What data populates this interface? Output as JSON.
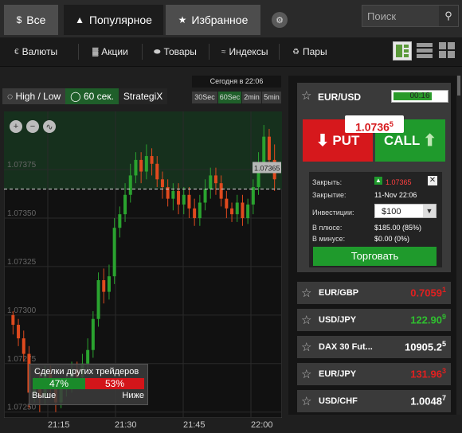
{
  "tabs": [
    {
      "label": "Все",
      "icon": "dollar-icon"
    },
    {
      "label": "Популярное",
      "icon": "flame-icon"
    },
    {
      "label": "Избранное",
      "icon": "star-icon"
    }
  ],
  "search": {
    "placeholder": "Поиск"
  },
  "categories": [
    "Валюты",
    "Акции",
    "Товары",
    "Индексы",
    "Пары"
  ],
  "option_types": [
    "High / Low",
    "60 сек.",
    "StrategiX"
  ],
  "expiry_label": "Сегодня в 22:06",
  "timeframes": [
    "30Sec",
    "60Sec",
    "2min",
    "5min"
  ],
  "colors": {
    "up": "#2aa32f",
    "down": "#e04a1e",
    "accent_green": "#1f9a2c",
    "put_red": "#d6181c"
  },
  "chart_data": {
    "type": "candlestick",
    "symbol": "EUR/USD",
    "y_ticks": [
      1.07375,
      1.0735,
      1.07325,
      1.073,
      1.07275,
      1.0725
    ],
    "x_ticks": [
      "21:15",
      "21:30",
      "21:45",
      "22:00"
    ],
    "current_price": 1.07365,
    "current_price_label": "1.07365",
    "ylim": [
      1.07247,
      1.07405
    ],
    "candles": [
      [
        1.073,
        1.07295,
        1.07302,
        1.0729
      ],
      [
        1.07295,
        1.07288,
        1.07298,
        1.07284
      ],
      [
        1.07288,
        1.0728,
        1.07292,
        1.07276
      ],
      [
        1.0728,
        1.0726,
        1.07284,
        1.07252
      ],
      [
        1.0726,
        1.07265,
        1.07268,
        1.07255
      ],
      [
        1.07265,
        1.07258,
        1.0727,
        1.0725
      ],
      [
        1.07258,
        1.0727,
        1.07274,
        1.07254
      ],
      [
        1.0727,
        1.07262,
        1.07274,
        1.07258
      ],
      [
        1.07262,
        1.07255,
        1.07266,
        1.0725
      ],
      [
        1.07255,
        1.07262,
        1.07266,
        1.07252
      ],
      [
        1.07262,
        1.07265,
        1.07268,
        1.07258
      ],
      [
        1.07265,
        1.07272,
        1.07276,
        1.0726
      ],
      [
        1.07272,
        1.07268,
        1.07276,
        1.07262
      ],
      [
        1.07268,
        1.07275,
        1.0728,
        1.07264
      ],
      [
        1.07275,
        1.07282,
        1.07288,
        1.07272
      ],
      [
        1.07282,
        1.07298,
        1.07302,
        1.07278
      ],
      [
        1.07298,
        1.07318,
        1.07322,
        1.07294
      ],
      [
        1.07318,
        1.07312,
        1.07324,
        1.07306
      ],
      [
        1.07312,
        1.0732,
        1.07326,
        1.07308
      ],
      [
        1.0732,
        1.07345,
        1.0735,
        1.07316
      ],
      [
        1.07345,
        1.07352,
        1.07356,
        1.0734
      ],
      [
        1.07352,
        1.07362,
        1.07368,
        1.07348
      ],
      [
        1.07362,
        1.07372,
        1.07378,
        1.07358
      ],
      [
        1.07372,
        1.0738,
        1.07384,
        1.07368
      ],
      [
        1.0738,
        1.07374,
        1.07384,
        1.07368
      ],
      [
        1.07374,
        1.07382,
        1.07388,
        1.0737
      ],
      [
        1.07382,
        1.07378,
        1.07386,
        1.07372
      ],
      [
        1.07378,
        1.0737,
        1.07382,
        1.07366
      ],
      [
        1.0737,
        1.07366,
        1.07374,
        1.0736
      ],
      [
        1.07366,
        1.0736,
        1.0737,
        1.07356
      ],
      [
        1.0736,
        1.07364,
        1.07368,
        1.07354
      ],
      [
        1.07364,
        1.07357,
        1.07368,
        1.07352
      ],
      [
        1.07357,
        1.07362,
        1.07366,
        1.07352
      ],
      [
        1.07362,
        1.07355,
        1.07366,
        1.0735
      ],
      [
        1.07355,
        1.0735,
        1.0736,
        1.07346
      ],
      [
        1.0735,
        1.07358,
        1.07362,
        1.07346
      ],
      [
        1.07358,
        1.07365,
        1.0737,
        1.07354
      ],
      [
        1.07365,
        1.07372,
        1.07376,
        1.0736
      ],
      [
        1.07372,
        1.07368,
        1.07376,
        1.07362
      ],
      [
        1.07368,
        1.0736,
        1.07372,
        1.07356
      ],
      [
        1.0736,
        1.07355,
        1.07364,
        1.0735
      ],
      [
        1.07355,
        1.07352,
        1.07358,
        1.07348
      ],
      [
        1.07352,
        1.07358,
        1.07362,
        1.07348
      ],
      [
        1.07358,
        1.0735,
        1.07362,
        1.07346
      ],
      [
        1.0735,
        1.07357,
        1.0736,
        1.07347
      ],
      [
        1.07357,
        1.07366,
        1.0737,
        1.07352
      ],
      [
        1.07366,
        1.07378,
        1.07384,
        1.07362
      ],
      [
        1.07378,
        1.07392,
        1.07398,
        1.07374
      ],
      [
        1.07392,
        1.0738,
        1.07396,
        1.07376
      ],
      [
        1.0738,
        1.0737,
        1.07388,
        1.07364
      ]
    ]
  },
  "traders": {
    "title": "Сделки других трейдеров",
    "up": "47%",
    "down": "53%",
    "up_label": "Выше",
    "down_label": "Ниже"
  },
  "active": {
    "asset": "EUR/USD",
    "timer": "00:16",
    "timer_fraction": 0.73,
    "price_main": "1.0736",
    "price_sup": "5",
    "put_label": "PUT",
    "call_label": "CALL",
    "close_label": "Закрыть:",
    "close_value": "1.07365",
    "closing_label": "Закрытие:",
    "closing_value": "11-Nov 22:06",
    "invest_label": "Инвестиции:",
    "invest_value": "$100",
    "profit_label": "В плюсе:",
    "profit_value": "$185.00 (85%)",
    "loss_label": "В минусе:",
    "loss_value": "$0.00 (0%)",
    "trade_label": "Торговать"
  },
  "assets": [
    {
      "name": "EUR/GBP",
      "main": "0.7059",
      "sup": "1",
      "dir": "red"
    },
    {
      "name": "USD/JPY",
      "main": "122.90",
      "sup": "9",
      "dir": "green"
    },
    {
      "name": "DAX 30 Fut...",
      "main": "10905.2",
      "sup": "5",
      "dir": "white"
    },
    {
      "name": "EUR/JPY",
      "main": "131.96",
      "sup": "3",
      "dir": "red"
    },
    {
      "name": "USD/CHF",
      "main": "1.0048",
      "sup": "7",
      "dir": "white"
    }
  ]
}
